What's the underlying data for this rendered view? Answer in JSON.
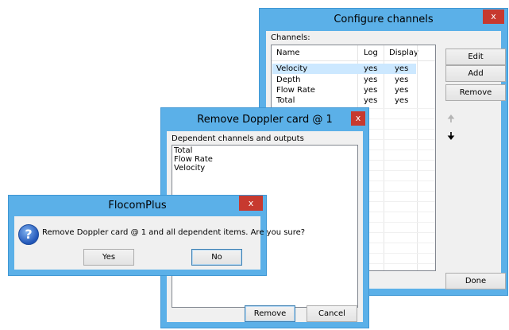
{
  "configure_channels": {
    "title": "Configure channels",
    "close_glyph": "x",
    "channels_label": "Channels:",
    "columns": [
      "Name",
      "Log",
      "Display"
    ],
    "rows": [
      {
        "name": "Velocity",
        "log": "yes",
        "display": "yes",
        "selected": true
      },
      {
        "name": "Depth",
        "log": "yes",
        "display": "yes",
        "selected": false
      },
      {
        "name": "Flow Rate",
        "log": "yes",
        "display": "yes",
        "selected": false
      },
      {
        "name": "Total",
        "log": "yes",
        "display": "yes",
        "selected": false
      }
    ],
    "buttons": {
      "edit": "Edit",
      "add": "Add",
      "remove": "Remove",
      "done": "Done"
    },
    "icons": {
      "move_up": "arrow-up-icon",
      "move_down": "arrow-down-icon"
    }
  },
  "remove_doppler": {
    "title": "Remove Doppler card @ 1",
    "close_glyph": "x",
    "dependents_label": "Dependent channels and outputs",
    "dependents": [
      "Total",
      "Flow Rate",
      "Velocity"
    ],
    "buttons": {
      "remove": "Remove",
      "cancel": "Cancel"
    }
  },
  "confirm": {
    "title": "FlocomPlus",
    "close_glyph": "x",
    "message": "Remove Doppler card @ 1 and all dependent items. Are you sure?",
    "icon": "question-icon",
    "icon_glyph": "?",
    "buttons": {
      "yes": "Yes",
      "no": "No"
    }
  },
  "colors": {
    "title_bar": "#5bb0e8",
    "close_button": "#c7392f",
    "selection": "#cce8ff",
    "pane": "#f0f0f0"
  }
}
